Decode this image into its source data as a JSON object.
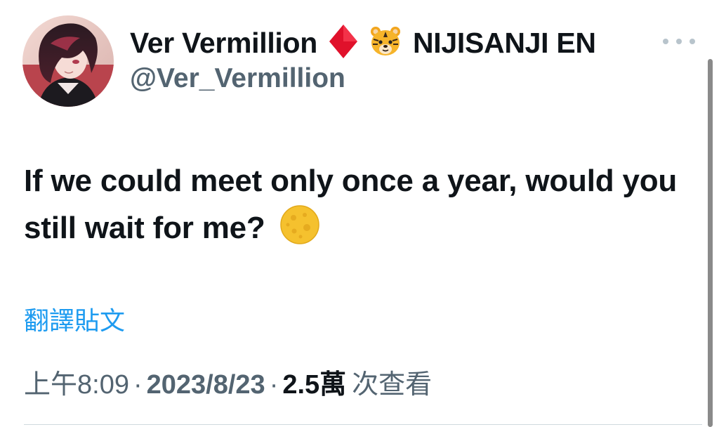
{
  "author": {
    "display_name": "Ver Vermillion",
    "affiliation": "NIJISANJI EN",
    "handle": "@Ver_Vermillion",
    "avatar_icon": "avatar",
    "badges": [
      "diamond-icon",
      "tiger-icon"
    ]
  },
  "tweet": {
    "text": "If we could meet only once a year, would you still wait for me?",
    "emoji": "moon-icon",
    "translate_label": "翻譯貼文"
  },
  "meta": {
    "time": "上午8:09",
    "separator": "·",
    "date": "2023/8/23",
    "views_count": "2.5萬",
    "views_label": "次查看"
  },
  "colors": {
    "link": "#1d9bf0",
    "secondary_text": "#536471",
    "primary_text": "#0f1419",
    "diamond": "#e0112b",
    "moon": "#f5c12e"
  }
}
